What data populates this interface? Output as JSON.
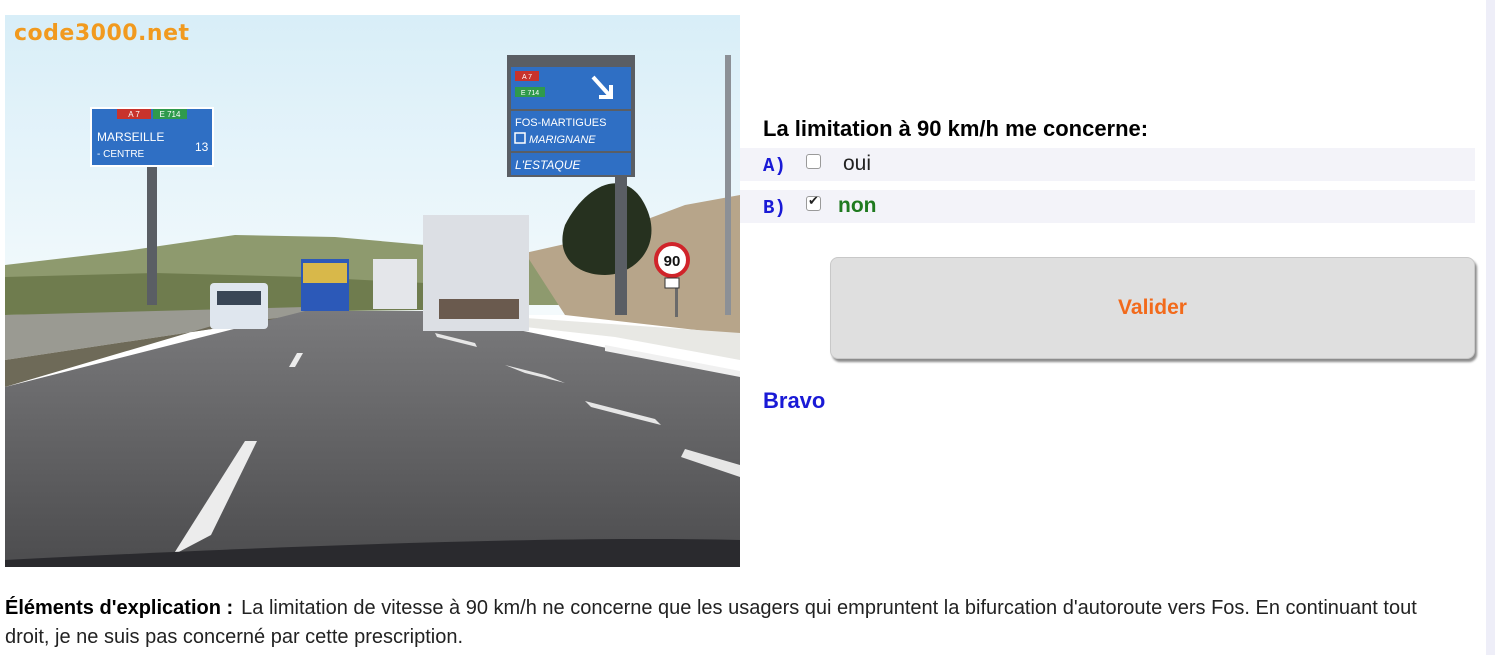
{
  "watermark": "code3000.net",
  "photo": {
    "sign_left": {
      "tags": [
        "A 7",
        "E 714"
      ],
      "destination": "MARSEILLE",
      "sub": "- CENTRE",
      "number": "13"
    },
    "sign_right": {
      "tags": [
        "A 7",
        "E 714"
      ],
      "destinations": [
        "FOS-MARTIGUES",
        "MARIGNANE"
      ],
      "bottom": "L'ESTAQUE"
    },
    "speed_limit": "90"
  },
  "question": "La limitation à 90 km/h me concerne:",
  "answers": [
    {
      "letter": "A)",
      "text": "oui",
      "checked": false,
      "correct": false
    },
    {
      "letter": "B)",
      "text": "non",
      "checked": true,
      "correct": true
    }
  ],
  "validate_label": "Valider",
  "result": "Bravo",
  "explanation": {
    "label": "Éléments d'explication :",
    "text": "La limitation de vitesse à 90 km/h ne concerne que les usagers qui empruntent la bifurcation d'autoroute vers Fos. En continuant tout droit, je ne suis pas concerné par cette prescription."
  },
  "colors": {
    "watermark": "#f19a1f",
    "answer_letter": "#1a1ad6",
    "correct_answer": "#1f7a1f",
    "button_label": "#f26a1b",
    "result": "#1a1ad6",
    "sign_blue": "#2f6fc4"
  }
}
